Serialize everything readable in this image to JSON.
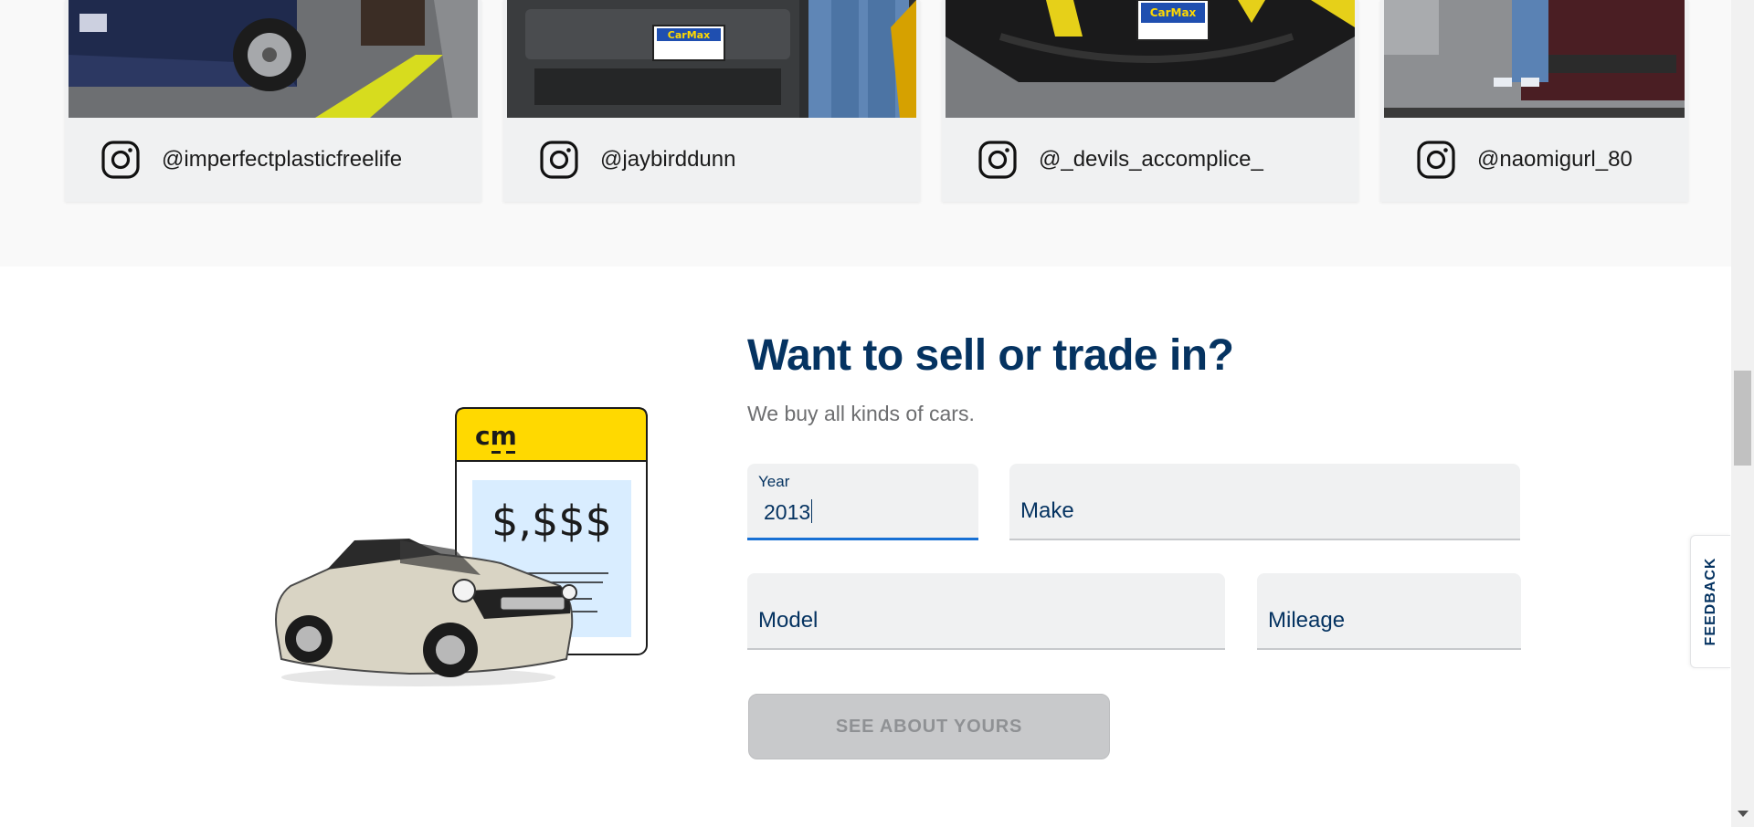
{
  "gallery": {
    "cards": [
      {
        "handle": "@imperfectplasticfreelife",
        "icon": "instagram-icon"
      },
      {
        "handle": "@jaybirddunn",
        "icon": "instagram-icon"
      },
      {
        "handle": "@_devils_accomplice_",
        "icon": "instagram-icon"
      },
      {
        "handle": "@naomigurl_80",
        "icon": "instagram-icon"
      }
    ],
    "plate_text": "CarMax"
  },
  "sell": {
    "heading": "Want to sell or trade in?",
    "subheading": "We buy all kinds of cars.",
    "illustration": {
      "logo": "cm",
      "price": "$,$$$"
    },
    "fields": {
      "year": {
        "label": "Year",
        "value": "2013"
      },
      "make": {
        "placeholder": "Make"
      },
      "model": {
        "placeholder": "Model"
      },
      "mileage": {
        "placeholder": "Mileage"
      }
    },
    "submit_label": "SEE ABOUT YOURS"
  },
  "feedback_label": "FEEDBACK",
  "colors": {
    "brand_navy": "#053361",
    "brand_yellow": "#ffd900",
    "focus_blue": "#1770d4",
    "disabled_button": "#c8c9cb"
  }
}
